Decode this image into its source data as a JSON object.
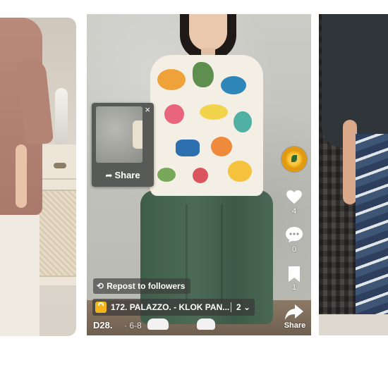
{
  "popup": {
    "close_label": "×",
    "share_label": "Share"
  },
  "side_actions": {
    "like_count": "4",
    "comment_count": "0",
    "bookmark_count": "1",
    "share_label": "Share"
  },
  "repost": {
    "label": "Repost to followers"
  },
  "product": {
    "title": "172. PALAZZO. -  KLOK PAN...",
    "count": "2"
  },
  "creator": {
    "name": "D28.",
    "date": "· 6-8"
  },
  "colors": {
    "accent": "#f2b51b",
    "overlay": "#585a57"
  }
}
